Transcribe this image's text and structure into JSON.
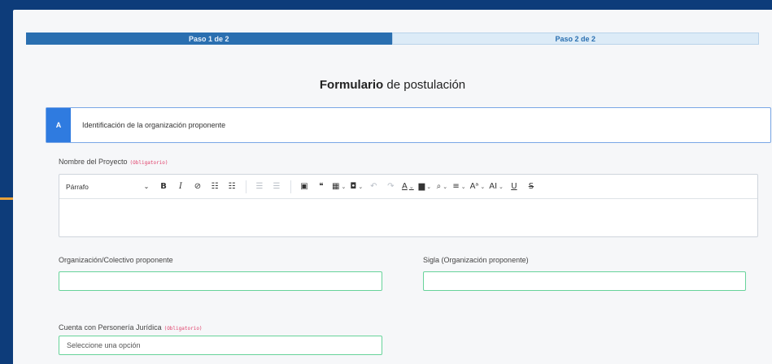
{
  "stepper": {
    "step1": "Paso 1 de 2",
    "step2": "Paso 2 de 2"
  },
  "form": {
    "title_bold": "Formulario",
    "title_rest": " de postulación"
  },
  "section": {
    "letter": "A",
    "title": "Identificación de la organización proponente"
  },
  "fields": {
    "project_name": {
      "label": "Nombre del Proyecto",
      "required": "(Obligatorio)"
    },
    "organization": {
      "label": "Organización/Colectivo proponente",
      "value": ""
    },
    "acronym": {
      "label": "Sigla (Organización proponente)",
      "value": ""
    },
    "legal": {
      "label": "Cuenta con Personería Jurídica",
      "required": "(Obligatorio)",
      "placeholder": "Seleccione una opción"
    }
  },
  "toolbar": {
    "paragraph": "Párrafo",
    "bold": "B",
    "italic": "I",
    "link": "⊘",
    "bullet_list": "☷",
    "numbered_list": "☷",
    "outdent": "☰",
    "indent": "☰",
    "image": "▣",
    "quote": "❝",
    "table": "▦",
    "media": "◘",
    "undo": "↶",
    "redo": "↷",
    "font_color": "A",
    "highlight": "▆",
    "find": "⌕",
    "align": "≡",
    "font_size": "Aᵃ",
    "case": "AI",
    "underline": "U",
    "strikethrough": "S"
  },
  "colors": {
    "brand_blue": "#0d3c7a",
    "step_active": "#2a6fb0",
    "section_accent": "#2f7be0",
    "valid_border": "#67d39a",
    "required_red": "#e0416b"
  }
}
